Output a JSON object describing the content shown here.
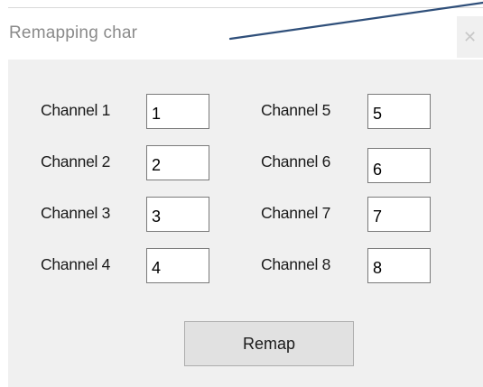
{
  "window": {
    "title": "Remapping char",
    "close_glyph": "✕",
    "close_icon": "close-icon"
  },
  "channels": [
    {
      "label": "Channel 1",
      "value": "1"
    },
    {
      "label": "Channel 2",
      "value": "2"
    },
    {
      "label": "Channel 3",
      "value": "3"
    },
    {
      "label": "Channel 4",
      "value": "4"
    },
    {
      "label": "Channel 5",
      "value": "5"
    },
    {
      "label": "Channel 6",
      "value": "6"
    },
    {
      "label": "Channel 7",
      "value": "7"
    },
    {
      "label": "Channel 8",
      "value": "8"
    }
  ],
  "actions": {
    "remap_label": "Remap"
  },
  "colors": {
    "client_background": "#f0f0f0",
    "title_text": "#8a8a8a",
    "annotation_line": "#2f4f7a"
  }
}
